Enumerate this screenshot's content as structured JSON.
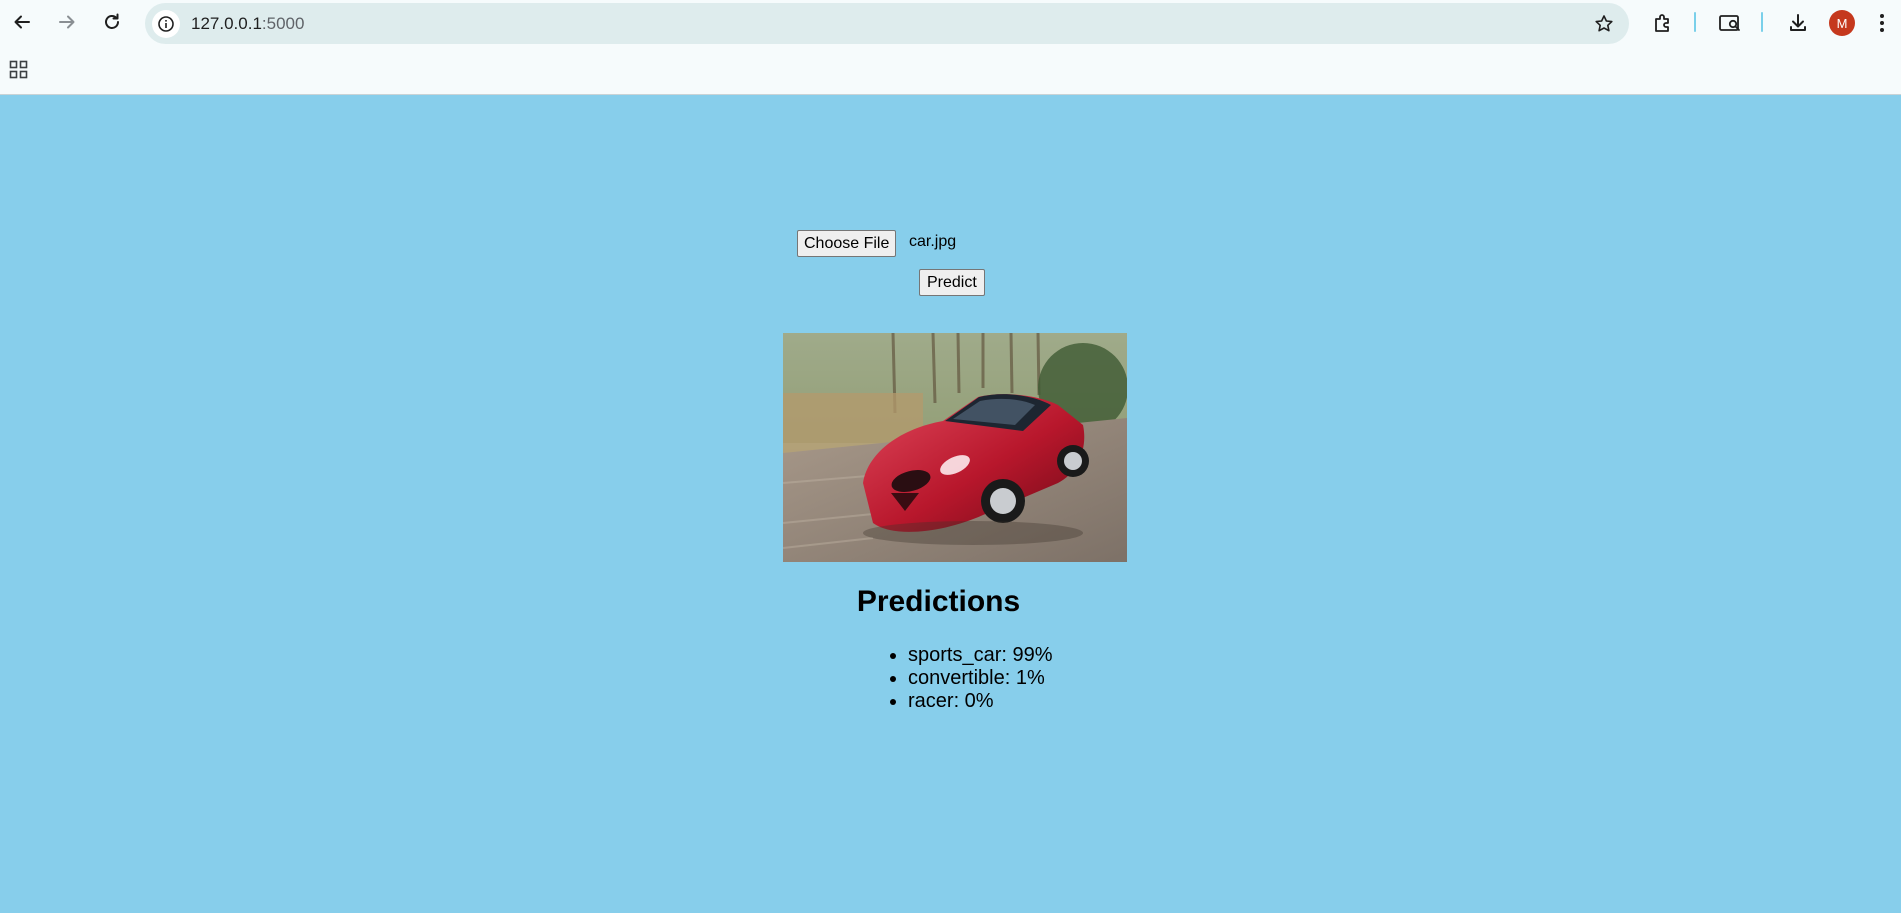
{
  "browser": {
    "url_host": "127.0.0.1",
    "url_port": ":5000",
    "profile_initial": "M",
    "icons": [
      "back-arrow-icon",
      "forward-arrow-icon",
      "reload-icon",
      "site-info-icon",
      "bookmark-star-icon",
      "extensions-icon",
      "tab-search-icon",
      "download-icon",
      "kebab-menu-icon",
      "apps-grid-icon"
    ]
  },
  "form": {
    "choose_file_label": "Choose File",
    "file_name": "car.jpg",
    "predict_label": "Predict"
  },
  "result": {
    "image_subject": "red sports car on road",
    "heading": "Predictions",
    "predictions": [
      "sports_car: 99%",
      "convertible: 1%",
      "racer: 0%"
    ]
  },
  "colors": {
    "page_background": "#87ceeb",
    "toolbar_background": "#f6fbfc",
    "omnibox_background": "#deeced",
    "avatar_background": "#c5381d"
  }
}
